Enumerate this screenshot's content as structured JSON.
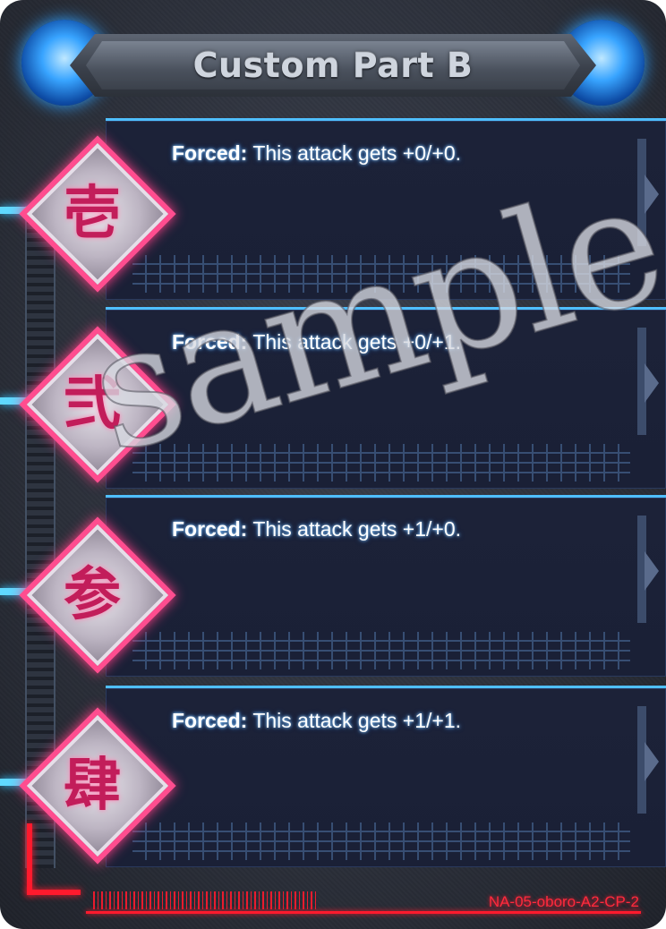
{
  "card": {
    "title": "Custom Part B",
    "watermark": "sample",
    "code": "NA-05-oboro-A2-CP-2",
    "accent": "#4fbfff",
    "diamond_color": "#ff4d8f",
    "code_color": "#ff1a2d"
  },
  "abilities": [
    {
      "numeral": "壱",
      "keyword": "Forced:",
      "text": " This attack gets +0/+0."
    },
    {
      "numeral": "弐",
      "keyword": "Forced:",
      "text": " This attack gets +0/+1."
    },
    {
      "numeral": "参",
      "keyword": "Forced:",
      "text": " This attack gets +1/+0."
    },
    {
      "numeral": "肆",
      "keyword": "Forced:",
      "text": " This attack gets +1/+1."
    }
  ]
}
